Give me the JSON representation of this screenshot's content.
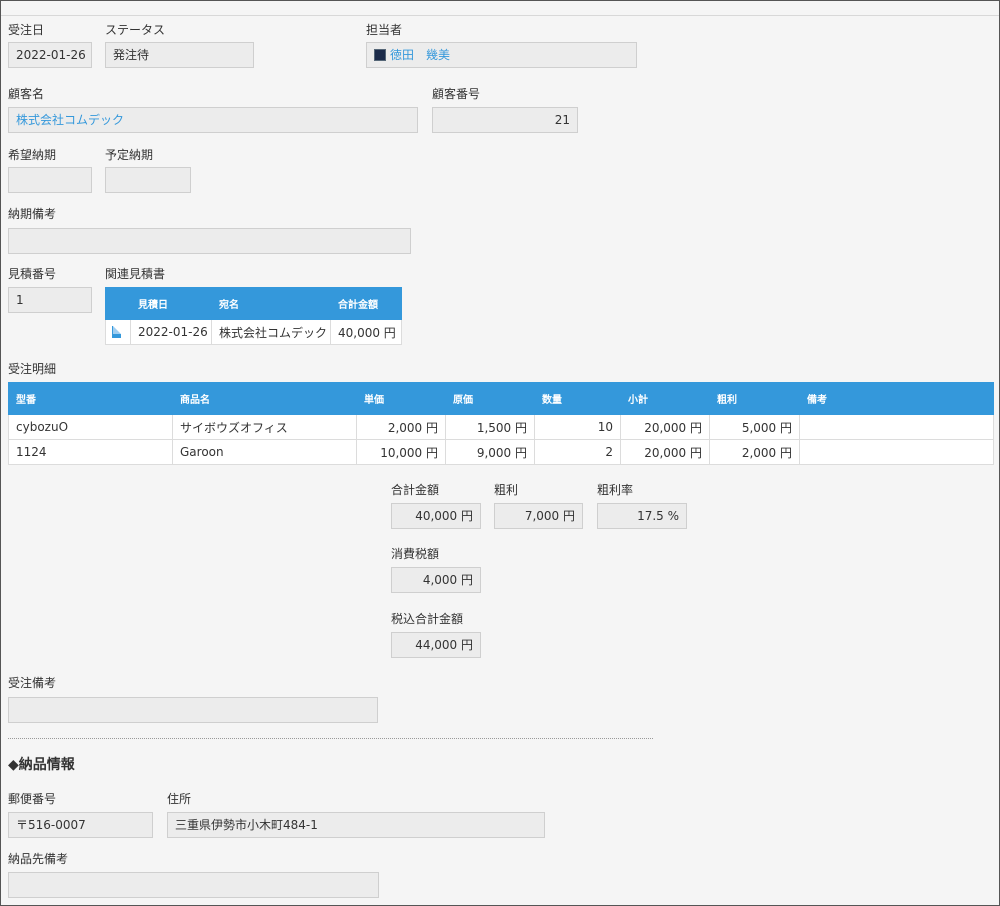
{
  "order": {
    "order_date_label": "受注日",
    "order_date": "2022-01-26",
    "status_label": "ステータス",
    "status": "発注待",
    "person_label": "担当者",
    "person": "徳田　幾美",
    "customer_label": "顧客名",
    "customer": "株式会社コムデック",
    "customer_no_label": "顧客番号",
    "customer_no": "21",
    "desired_delivery_label": "希望納期",
    "desired_delivery": "",
    "planned_delivery_label": "予定納期",
    "planned_delivery": "",
    "delivery_note_label": "納期備考",
    "delivery_note": "",
    "estimate_no_label": "見積番号",
    "estimate_no": "1"
  },
  "related_estimates": {
    "label": "関連見積書",
    "headers": [
      "見積日",
      "宛名",
      "合計金額"
    ],
    "rows": [
      {
        "date": "2022-01-26",
        "addressee": "株式会社コムデック",
        "total": "40,000 円"
      }
    ]
  },
  "details": {
    "label": "受注明細",
    "headers": [
      "型番",
      "商品名",
      "単価",
      "原価",
      "数量",
      "小計",
      "粗利",
      "備考"
    ],
    "rows": [
      {
        "model": "cybozuO",
        "product": "サイボウズオフィス",
        "unit_price": "2,000 円",
        "cost": "1,500 円",
        "qty": "10",
        "subtotal": "20,000 円",
        "gross_profit": "5,000 円",
        "note": ""
      },
      {
        "model": "1124",
        "product": "Garoon",
        "unit_price": "10,000 円",
        "cost": "9,000 円",
        "qty": "2",
        "subtotal": "20,000 円",
        "gross_profit": "2,000 円",
        "note": ""
      }
    ]
  },
  "totals": {
    "total_label": "合計金額",
    "total": "40,000 円",
    "gross_label": "粗利",
    "gross": "7,000 円",
    "gross_rate_label": "粗利率",
    "gross_rate": "17.5 %",
    "tax_label": "消費税額",
    "tax": "4,000 円",
    "total_incl_label": "税込合計金額",
    "total_incl": "44,000 円"
  },
  "order_note": {
    "label": "受注備考",
    "value": ""
  },
  "delivery": {
    "section_title": "◆納品情報",
    "postal_label": "郵便番号",
    "postal": "〒516-0007",
    "address_label": "住所",
    "address": "三重県伊勢市小木町484-1",
    "note_label": "納品先備考",
    "note": ""
  },
  "colors": {
    "accent": "#3498db",
    "field_bg": "#ececec",
    "page_bg": "#f5f5f5"
  }
}
